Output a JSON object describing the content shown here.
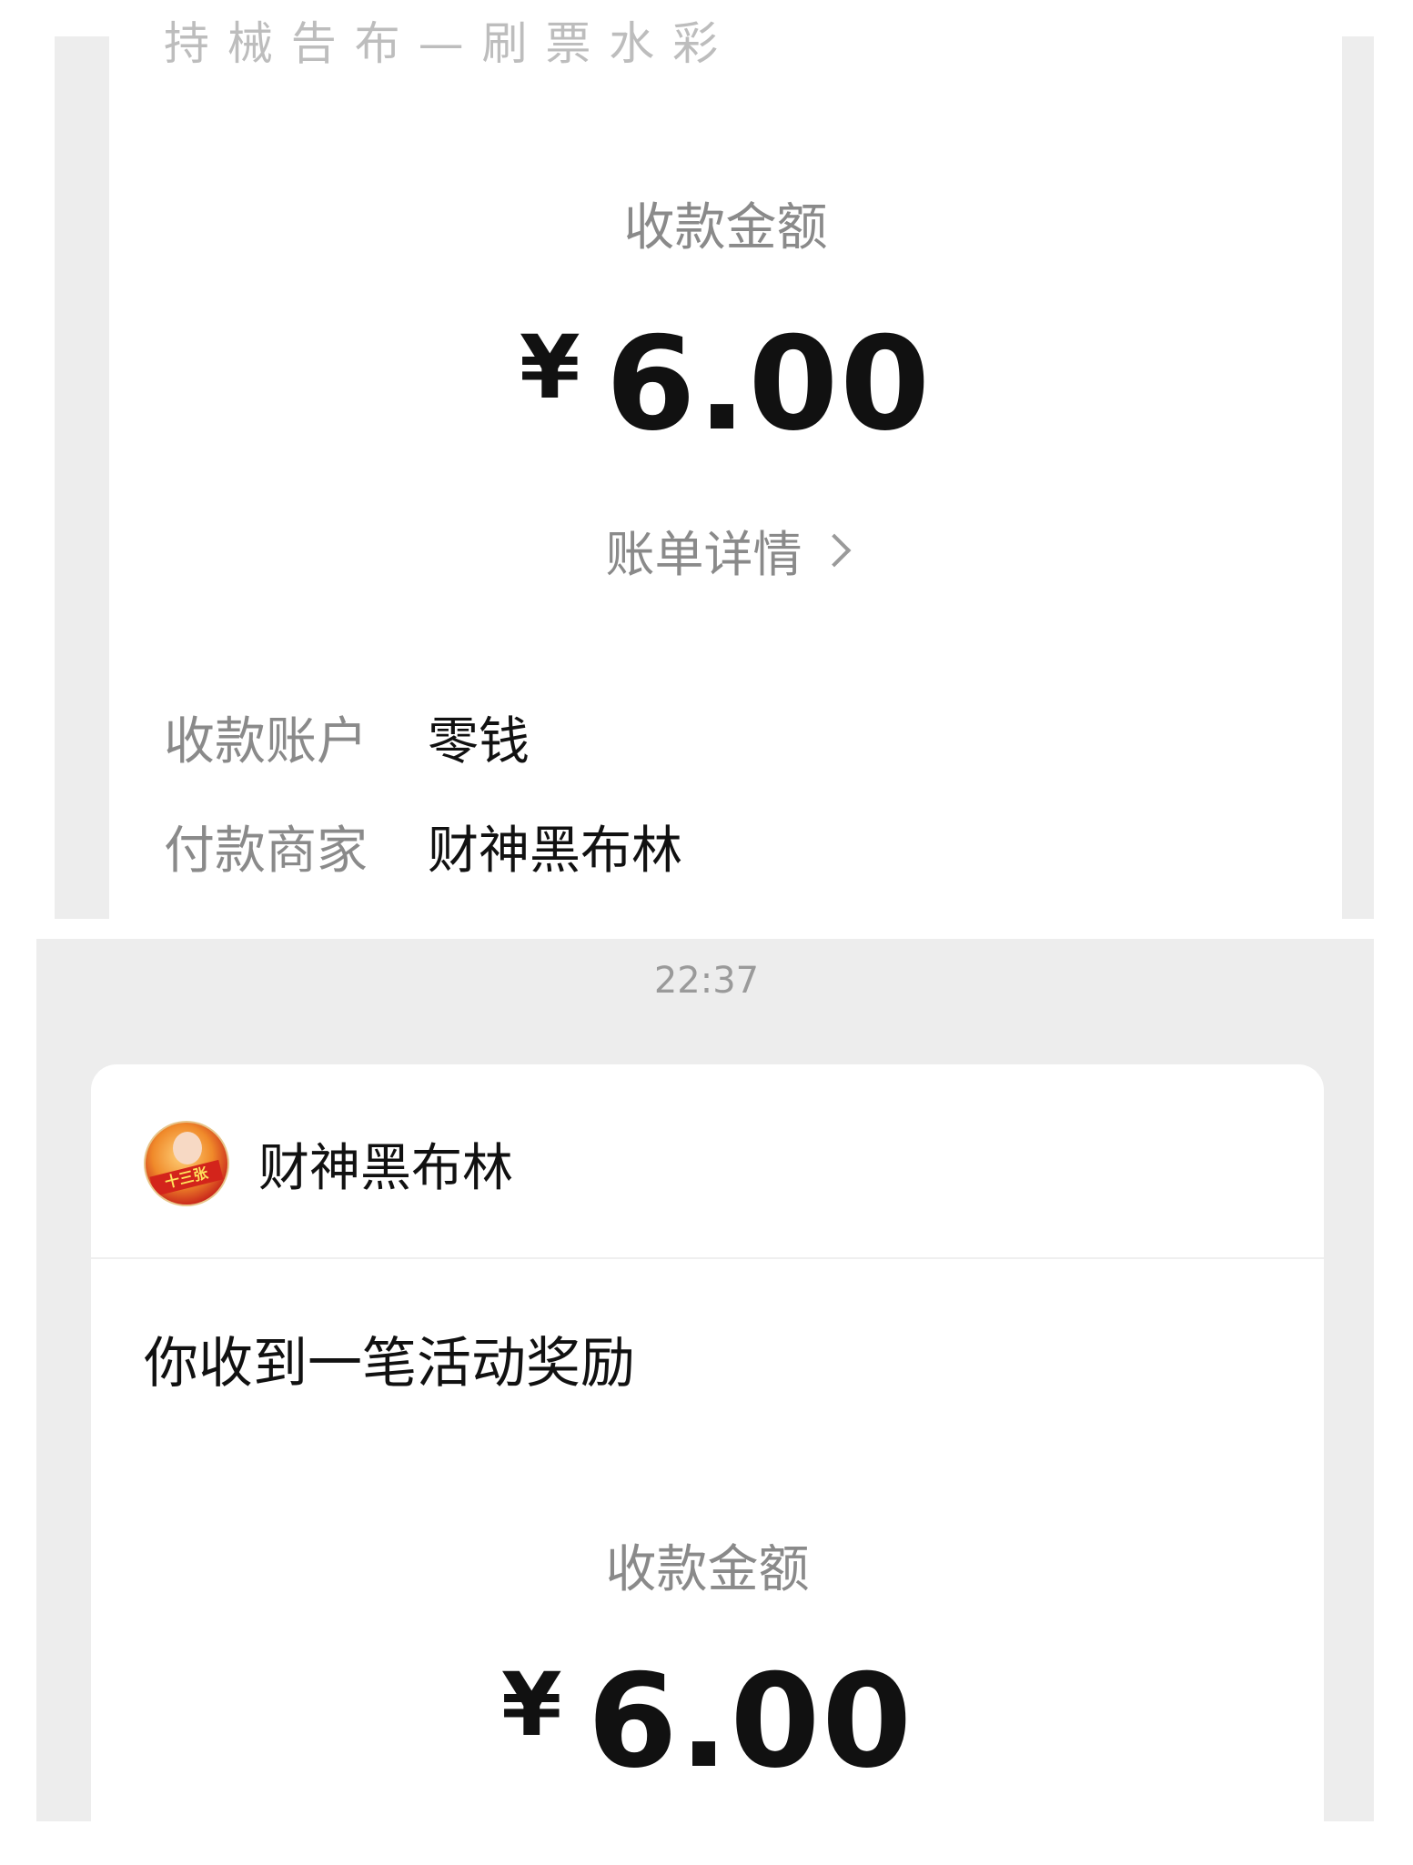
{
  "top_card": {
    "truncated_heading": "持 械 告 布 — 刷 票 水 彩",
    "amount_label": "收款金额",
    "currency": "¥",
    "amount": "6.00",
    "bill_details_link": "账单详情",
    "rows": [
      {
        "key": "收款账户",
        "value": "零钱"
      },
      {
        "key": "付款商家",
        "value": "财神黑布林"
      }
    ]
  },
  "timestamp": "22:37",
  "bottom_card": {
    "merchant_name": "财神黑布林",
    "avatar_badge_text": "十三张",
    "message_title": "你收到一笔活动奖励",
    "amount_label": "收款金额",
    "currency": "¥",
    "amount": "6.00"
  },
  "colors": {
    "background_gray": "#ededed",
    "card_white": "#ffffff",
    "label_gray": "#8a8a8a",
    "text_black": "#111111"
  },
  "icons": [
    "chevron-right-icon",
    "merchant-avatar"
  ]
}
